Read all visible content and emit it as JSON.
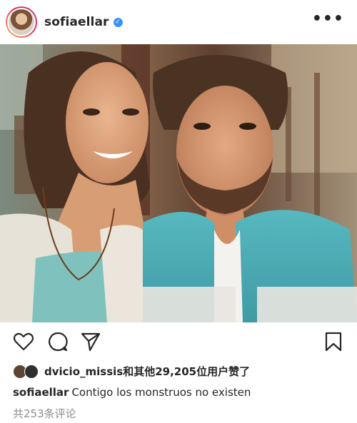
{
  "header": {
    "username": "sofiaellar",
    "verified_icon": "verified-badge-icon",
    "more_label": "•••"
  },
  "post": {
    "image_alt": "Couple selfie at a cafe"
  },
  "actions": {
    "like_icon": "heart-icon",
    "comment_icon": "comment-icon",
    "share_icon": "send-icon",
    "save_icon": "bookmark-icon"
  },
  "likes": {
    "text": "dvicio_missis和其他29,205位用户赞了"
  },
  "caption": {
    "user": "sofiaellar",
    "text": "Contigo los monstruos no existen"
  },
  "comments": {
    "text": "共253条评论"
  },
  "colors": {
    "text": "#262626",
    "muted": "#8e8e8e",
    "verified": "#3897f0"
  }
}
